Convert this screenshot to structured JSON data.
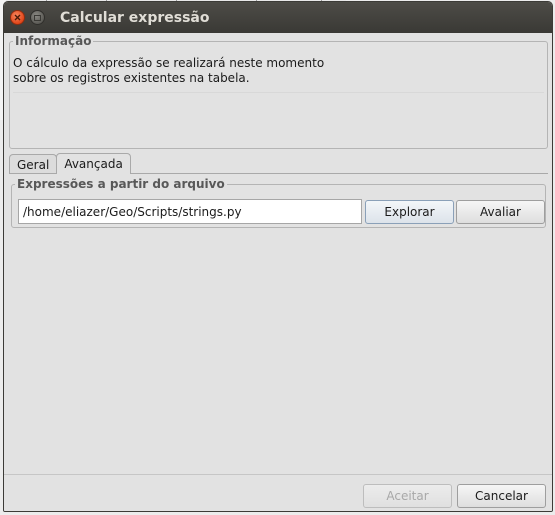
{
  "window": {
    "title": "Calcular expressão"
  },
  "info": {
    "legend": "Informação",
    "line1": "O cálculo da expressão se realizará neste momento",
    "line2": "sobre os registros existentes na tabela."
  },
  "tabs": [
    {
      "label": "Geral",
      "active": false
    },
    {
      "label": "Avançada",
      "active": true
    }
  ],
  "expressions": {
    "legend": "Expressões a partir do arquivo",
    "path_value": "/home/eliazer/Geo/Scripts/strings.py",
    "explore_label": "Explorar",
    "evaluate_label": "Avaliar"
  },
  "footer": {
    "accept_label": "Aceitar",
    "cancel_label": "Cancelar",
    "accept_enabled": false
  },
  "colors": {
    "titlebar": "#3c3b37",
    "close_button": "#e0461a",
    "dialog_background": "#e2e2e2"
  }
}
